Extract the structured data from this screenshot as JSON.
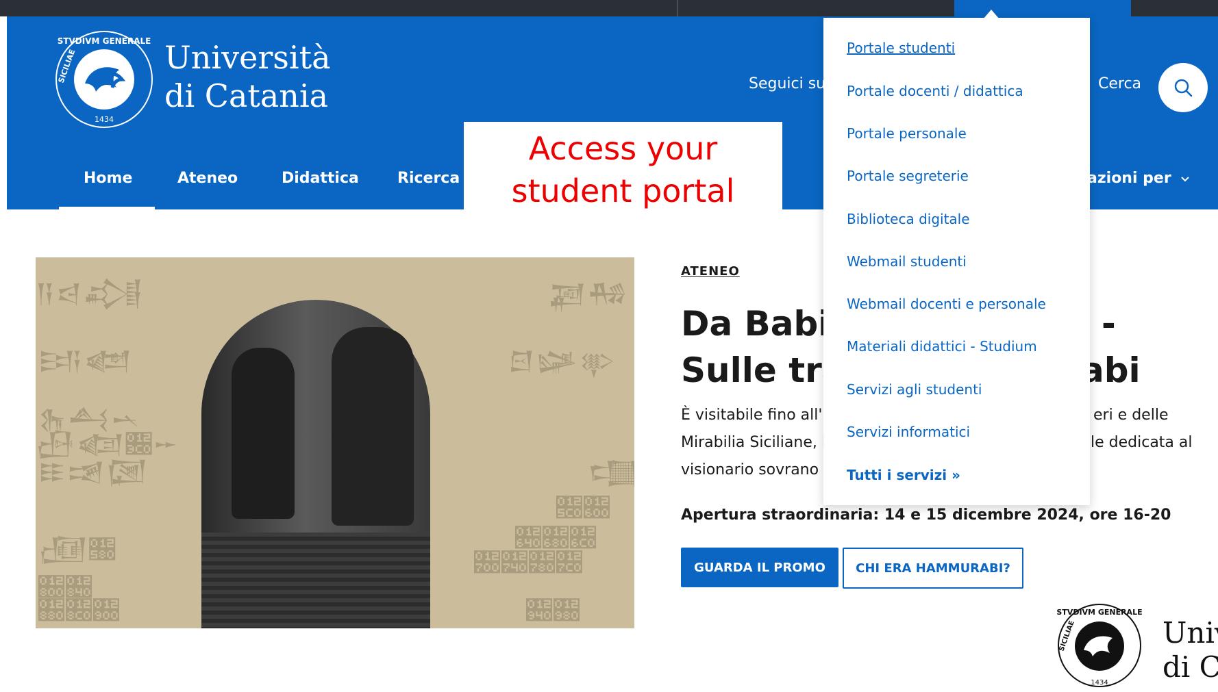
{
  "header": {
    "brand_line1": "Università",
    "brand_line2": "di Catania",
    "seguici": "Seguici su",
    "cerca": "Cerca",
    "azioni": "azioni per",
    "logo_seal": {
      "top": "STVDIVM GENERALE",
      "left": "SICILIAE",
      "year": "1434"
    }
  },
  "nav": {
    "items": [
      "Home",
      "Ateneo",
      "Didattica",
      "Ricerca"
    ]
  },
  "callout": {
    "line1": "Access your",
    "line2": "student portal"
  },
  "dropdown": {
    "items": [
      "Portale studenti",
      "Portale docenti / didattica",
      "Portale personale",
      "Portale segreterie",
      "Biblioteca digitale",
      "Webmail studenti",
      "Webmail docenti e personale",
      "Materiali didattici - Studium",
      "Servizi agli studenti",
      "Servizi informatici",
      "Tutti i servizi »"
    ]
  },
  "article": {
    "kicker": "ATENEO",
    "title_line1_left": "Da Babil",
    "title_line1_right": "-",
    "title_line2_left": "Sulle tra",
    "title_line2_right": "abi",
    "body_line1_left": "È visitabile fino all'",
    "body_line1_right": "eri e delle",
    "body_line2_left": "Mirabilia Siciliane, l",
    "body_line2_right": "le dedicata al",
    "body_line3_left": "visionario sovrano",
    "apertura": "Apertura straordinaria: 14 e 15 dicembre 2024, ore 16-20",
    "btn_primary": "GUARDA IL PROMO",
    "btn_outline": "CHI ERA HAMMURABI?"
  },
  "footer": {
    "brand_line1": "Univ",
    "brand_line2": "di C"
  },
  "colors": {
    "brand_blue": "#0a66c2",
    "callout_red": "#ee0000",
    "topbar": "#2b2f36"
  }
}
